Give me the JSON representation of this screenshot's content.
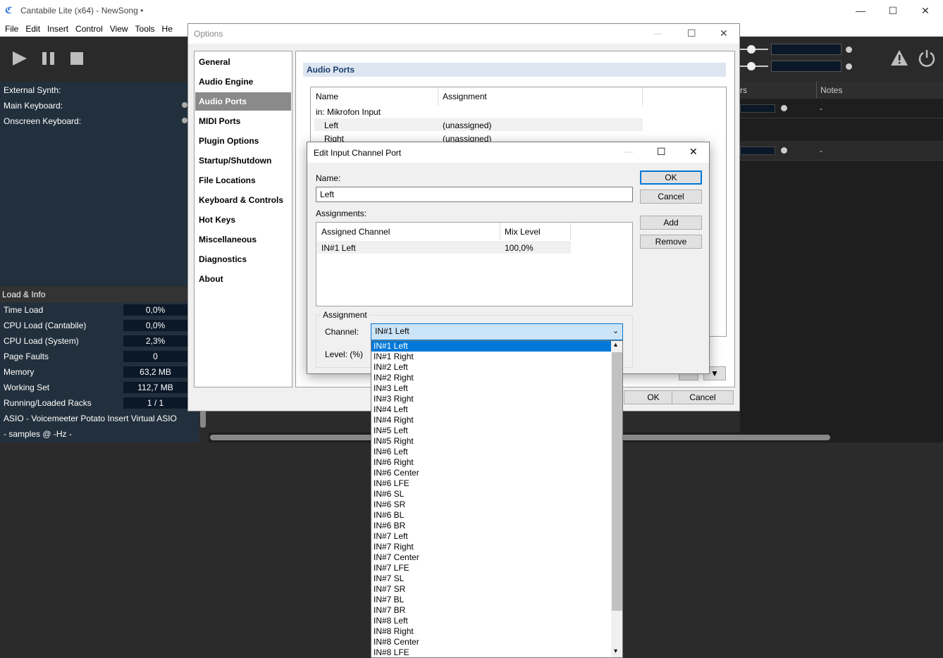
{
  "app": {
    "title": "Cantabile Lite (x64) - NewSong •",
    "menu": [
      "File",
      "Edit",
      "Insert",
      "Control",
      "View",
      "Tools",
      "He"
    ]
  },
  "left_panel": {
    "items": [
      "External Synth:",
      "Main Keyboard:",
      "Onscreen Keyboard:"
    ]
  },
  "load_info": {
    "header": "Load & Info",
    "rows": [
      {
        "label": "Time Load",
        "value": "0,0%"
      },
      {
        "label": "CPU Load (Cantabile)",
        "value": "0,0%"
      },
      {
        "label": "CPU Load (System)",
        "value": "2,3%"
      },
      {
        "label": "Page Faults",
        "value": "0"
      },
      {
        "label": "Memory",
        "value": "63,2 MB"
      },
      {
        "label": "Working Set",
        "value": "112,7 MB"
      },
      {
        "label": "Running/Loaded Racks",
        "value": "1 / 1"
      }
    ],
    "asio": "ASIO - Voicemeeter Potato Insert Virtual ASIO",
    "samples": "- samples @ -Hz -"
  },
  "right_table": {
    "col1": "rs",
    "col2": "Notes",
    "row_values": [
      "-",
      "-"
    ]
  },
  "options": {
    "title": "Options",
    "nav": [
      "General",
      "Audio Engine",
      "Audio Ports",
      "MIDI Ports",
      "Plugin Options",
      "Startup/Shutdown",
      "File Locations",
      "Keyboard & Controls",
      "Hot Keys",
      "Miscellaneous",
      "Diagnostics",
      "About"
    ],
    "section": "Audio Ports",
    "table": {
      "col_name": "Name",
      "col_assign": "Assignment",
      "group": "in: Mikrofon Input",
      "rows": [
        {
          "name": "Left",
          "assign": "(unassigned)"
        },
        {
          "name": "Right",
          "assign": "(unassigned)"
        }
      ]
    },
    "ok": "OK",
    "cancel": "Cancel"
  },
  "edit": {
    "title": "Edit Input Channel Port",
    "name_label": "Name:",
    "name_value": "Left",
    "assignments_label": "Assignments:",
    "list": {
      "col1": "Assigned Channel",
      "col2": "Mix Level",
      "rows": [
        {
          "channel": "IN#1 Left",
          "level": "100,0%"
        }
      ]
    },
    "group_label": "Assignment",
    "channel_label": "Channel:",
    "channel_value": "IN#1 Left",
    "level_label": "Level: (%)",
    "buttons": {
      "ok": "OK",
      "cancel": "Cancel",
      "add": "Add",
      "remove": "Remove"
    }
  },
  "dropdown": {
    "items": [
      "IN#1 Left",
      "IN#1 Right",
      "IN#2 Left",
      "IN#2 Right",
      "IN#3 Left",
      "IN#3 Right",
      "IN#4 Left",
      "IN#4 Right",
      "IN#5 Left",
      "IN#5 Right",
      "IN#6 Left",
      "IN#6 Right",
      "IN#6 Center",
      "IN#6 LFE",
      "IN#6 SL",
      "IN#6 SR",
      "IN#6 BL",
      "IN#6 BR",
      "IN#7 Left",
      "IN#7 Right",
      "IN#7 Center",
      "IN#7 LFE",
      "IN#7 SL",
      "IN#7 SR",
      "IN#7 BL",
      "IN#7 BR",
      "IN#8 Left",
      "IN#8 Right",
      "IN#8 Center",
      "IN#8 LFE"
    ],
    "selected_index": 0
  }
}
